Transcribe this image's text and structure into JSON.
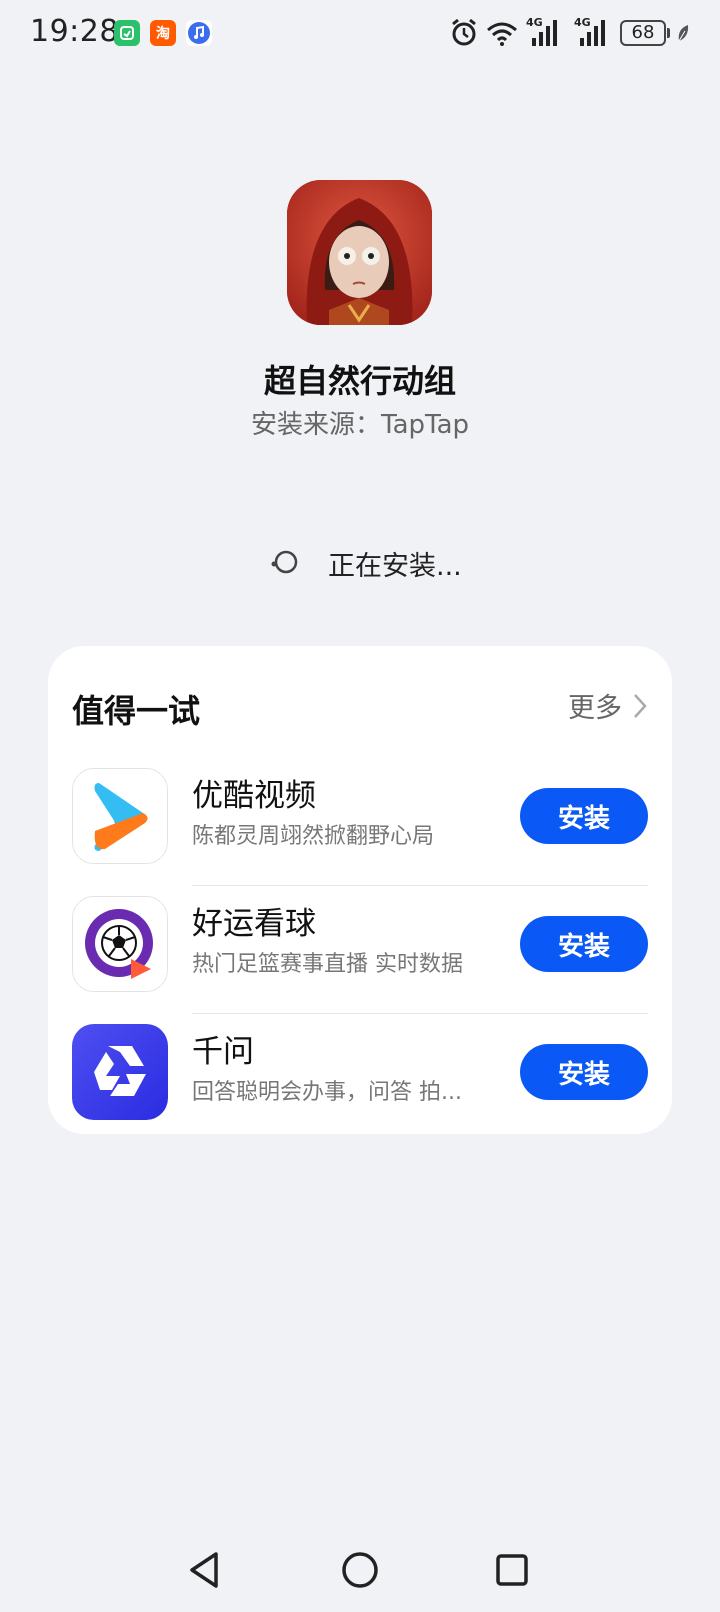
{
  "status_bar": {
    "time": "19:28",
    "notification_icons": [
      "mi-home-icon",
      "taobao-icon",
      "music-icon"
    ],
    "taobao_label": "淘",
    "network_label_1": "4G",
    "network_label_2": "4G",
    "battery": "68"
  },
  "app": {
    "name": "超自然行动组",
    "source": "安装来源：TapTap",
    "status": "正在安装..."
  },
  "recommend": {
    "title": "值得一试",
    "more": "更多",
    "items": [
      {
        "name": "优酷视频",
        "desc": "陈都灵周翊然掀翻野心局",
        "button": "安装"
      },
      {
        "name": "好运看球",
        "desc": "热门足篮赛事直播 实时数据",
        "button": "安装"
      },
      {
        "name": "千问",
        "desc": "回答聪明会办事，问答 拍...",
        "button": "安装"
      }
    ]
  },
  "colors": {
    "background": "#f1f2f5",
    "accent": "#0a59f7"
  }
}
